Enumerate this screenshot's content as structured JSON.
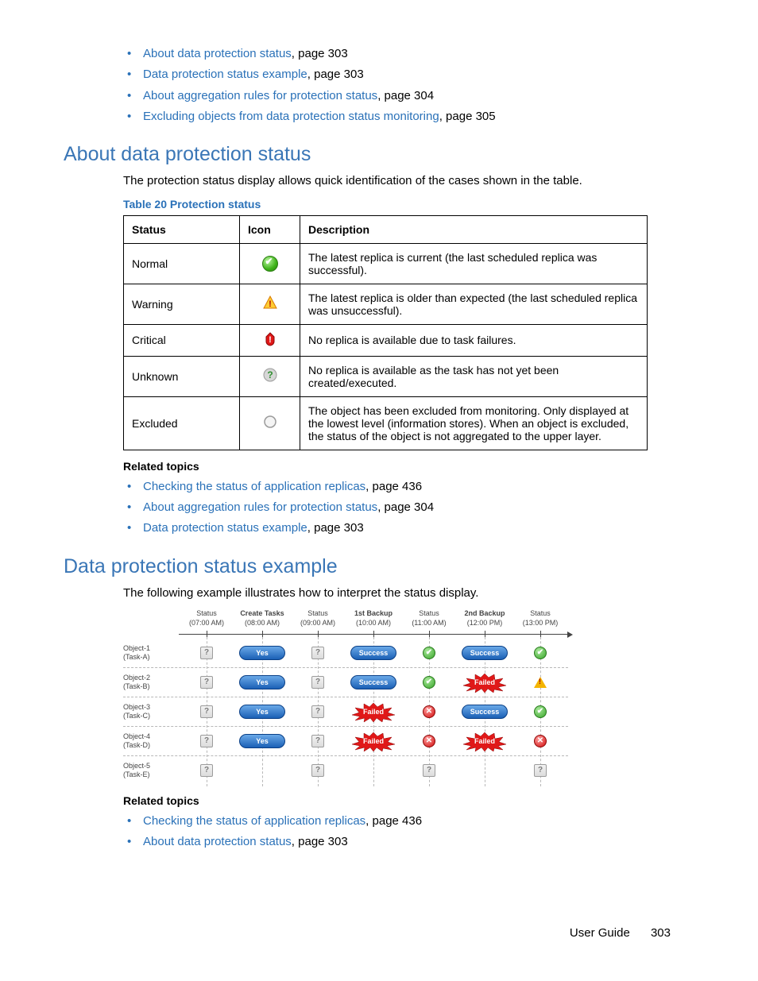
{
  "toc": [
    {
      "link": "About data protection status",
      "after": ", page 303"
    },
    {
      "link": "Data protection status example",
      "after": ", page 303"
    },
    {
      "link": "About aggregation rules for protection status",
      "after": ", page 304"
    },
    {
      "link": "Excluding objects from data protection status monitoring",
      "after": ", page 305"
    }
  ],
  "sec1": {
    "heading": "About data protection status",
    "para": "The protection status display allows quick identification of the cases shown in the table.",
    "caption": "Table 20 Protection status",
    "th": {
      "status": "Status",
      "icon": "Icon",
      "desc": "Description"
    },
    "rows": [
      {
        "status": "Normal",
        "icon": "normal",
        "desc": "The latest replica is current (the last scheduled replica was successful)."
      },
      {
        "status": "Warning",
        "icon": "warn",
        "desc": "The latest replica is older than expected (the last scheduled replica was unsuccessful)."
      },
      {
        "status": "Critical",
        "icon": "crit",
        "desc": "No replica is available due to task failures."
      },
      {
        "status": "Unknown",
        "icon": "unk",
        "desc": "No replica is available as the task has not yet been created/executed."
      },
      {
        "status": "Excluded",
        "icon": "excl",
        "desc": "The object has been excluded from monitoring. Only displayed at the lowest level (information stores). When an object is excluded, the status of the object is not aggregated to the upper layer."
      }
    ],
    "related_h": "Related topics",
    "related": [
      {
        "link": "Checking the status of application replicas",
        "after": ", page 436"
      },
      {
        "link": "About aggregation rules for protection status",
        "after": ", page 304"
      },
      {
        "link": "Data protection status example",
        "after": ", page 303"
      }
    ]
  },
  "sec2": {
    "heading": "Data protection status example",
    "para": "The following example illustrates how to interpret the status display.",
    "headers": [
      {
        "l1": "Status",
        "l2": "(07:00 AM)",
        "bold": false
      },
      {
        "l1": "Create Tasks",
        "l2": "(08:00 AM)",
        "bold": true
      },
      {
        "l1": "Status",
        "l2": "(09:00 AM)",
        "bold": false
      },
      {
        "l1": "1st Backup",
        "l2": "(10:00 AM)",
        "bold": true
      },
      {
        "l1": "Status",
        "l2": "(11:00 AM)",
        "bold": false
      },
      {
        "l1": "2nd Backup",
        "l2": "(12:00 PM)",
        "bold": true
      },
      {
        "l1": "Status",
        "l2": "(13:00 PM)",
        "bold": false
      }
    ],
    "rows": [
      {
        "label": "Object-1\n(Task-A)",
        "cells": [
          "q",
          "yes",
          "q",
          "success",
          "g",
          "success",
          "g"
        ]
      },
      {
        "label": "Object-2\n(Task-B)",
        "cells": [
          "q",
          "yes",
          "q",
          "success",
          "g",
          "failed",
          "w"
        ]
      },
      {
        "label": "Object-3\n(Task-C)",
        "cells": [
          "q",
          "yes",
          "q",
          "failed",
          "r",
          "success",
          "g"
        ]
      },
      {
        "label": "Object-4\n(Task-D)",
        "cells": [
          "q",
          "yes",
          "q",
          "failed",
          "r",
          "failed",
          "r"
        ]
      },
      {
        "label": "Object-5\n(Task-E)",
        "cells": [
          "q",
          "",
          "q",
          "",
          "q",
          "",
          "q"
        ]
      }
    ],
    "labels": {
      "yes": "Yes",
      "success": "Success",
      "failed": "Failed"
    },
    "related_h": "Related topics",
    "related": [
      {
        "link": "Checking the status of application replicas",
        "after": ", page 436"
      },
      {
        "link": "About data protection status",
        "after": ", page 303"
      }
    ]
  },
  "footer": {
    "label": "User Guide",
    "page": "303"
  }
}
